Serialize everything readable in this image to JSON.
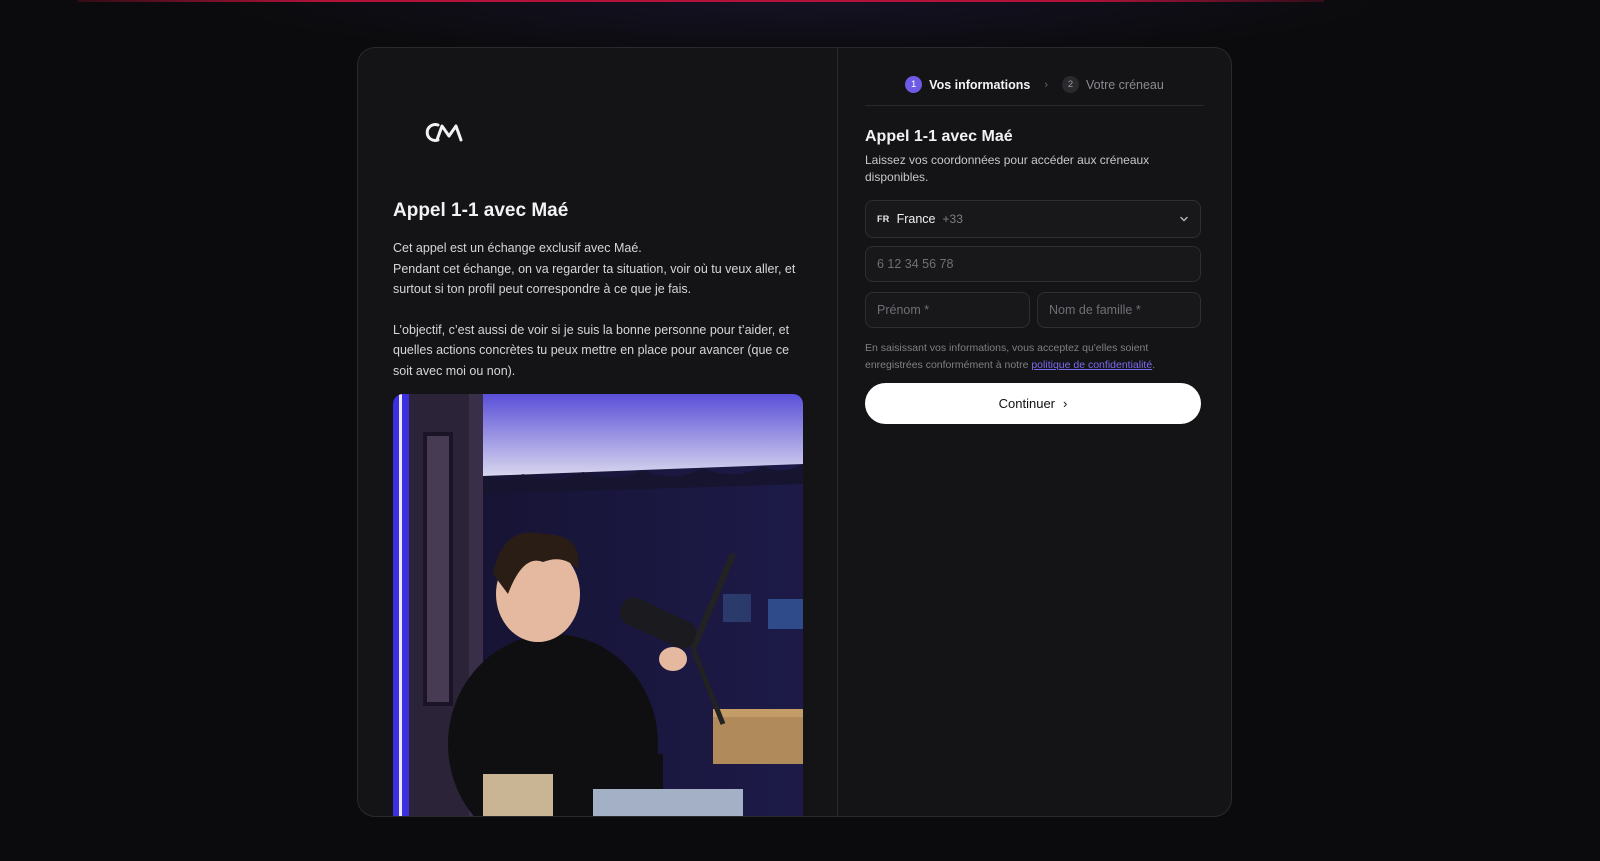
{
  "left_panel": {
    "logo_icon": "cm-logo-icon",
    "title": "Appel 1-1 avec Maé",
    "desc_line1": "Cet appel est un échange exclusif avec Maé.",
    "desc_line2": "Pendant cet échange, on va regarder ta situation, voir où tu veux aller, et surtout si ton profil peut correspondre à ce que je fais.",
    "desc_para2": "L’objectif, c’est aussi de voir si je suis la bonne personne pour t’aider, et quelles actions concrètes tu peux mettre en place pour avancer (que ce soit avec moi ou non)."
  },
  "stepper": {
    "steps": [
      {
        "num": "1",
        "label": "Vos informations"
      },
      {
        "num": "2",
        "label": "Votre créneau"
      }
    ],
    "separator": "›"
  },
  "form": {
    "title": "Appel 1-1 avec Maé",
    "subtitle": "Laissez vos coordonnées pour accéder aux créneaux disponibles.",
    "country": {
      "code": "FR",
      "name": "France",
      "dial": "+33"
    },
    "phone_placeholder": "6 12 34 56 78",
    "first_name_placeholder": "Prénom *",
    "last_name_placeholder": "Nom de famille *",
    "consent_text": "En saisissant vos informations, vous acceptez qu'elles soient enregistrées conformément à notre ",
    "consent_link": "politique de confidentialité",
    "consent_end": ".",
    "continue_label": "Continuer",
    "continue_arrow": "›"
  },
  "colors": {
    "accent": "#6d5be6",
    "background": "#0b0b0d",
    "card": "#141416"
  }
}
